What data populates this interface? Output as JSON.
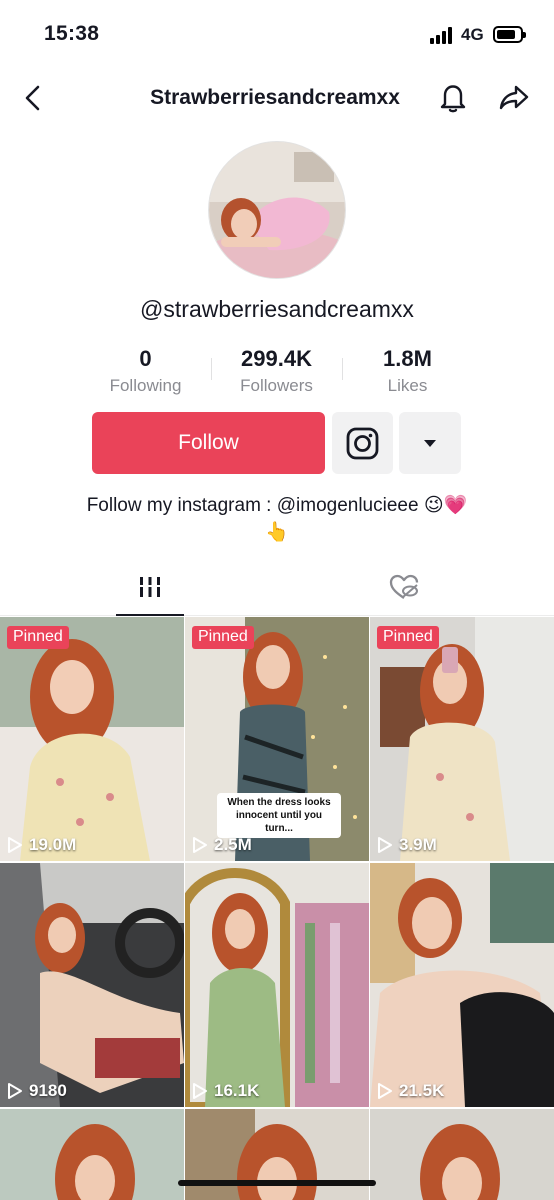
{
  "status_bar": {
    "time": "15:38",
    "network": "4G"
  },
  "header": {
    "title": "Strawberriesandcreamxx"
  },
  "profile": {
    "handle": "@strawberriesandcreamxx",
    "stats": [
      {
        "value": "0",
        "label": "Following"
      },
      {
        "value": "299.4K",
        "label": "Followers"
      },
      {
        "value": "1.8M",
        "label": "Likes"
      }
    ],
    "follow_label": "Follow",
    "bio_line1": "Follow my instagram : @imogenlucieee 😉💗",
    "bio_line2": "👆"
  },
  "tabs": [
    "videos-grid-icon",
    "liked-hidden-icon"
  ],
  "videos": [
    {
      "pinned": "Pinned",
      "views": "19.0M"
    },
    {
      "pinned": "Pinned",
      "views": "2.5M",
      "caption": "When the dress looks innocent until you turn..."
    },
    {
      "pinned": "Pinned",
      "views": "3.9M"
    },
    {
      "views": "9180"
    },
    {
      "views": "16.1K"
    },
    {
      "views": "21.5K"
    }
  ],
  "colors": {
    "accent": "#ea4359",
    "secondary_bg": "#f1f1f2",
    "muted_text": "#8a8b91"
  }
}
